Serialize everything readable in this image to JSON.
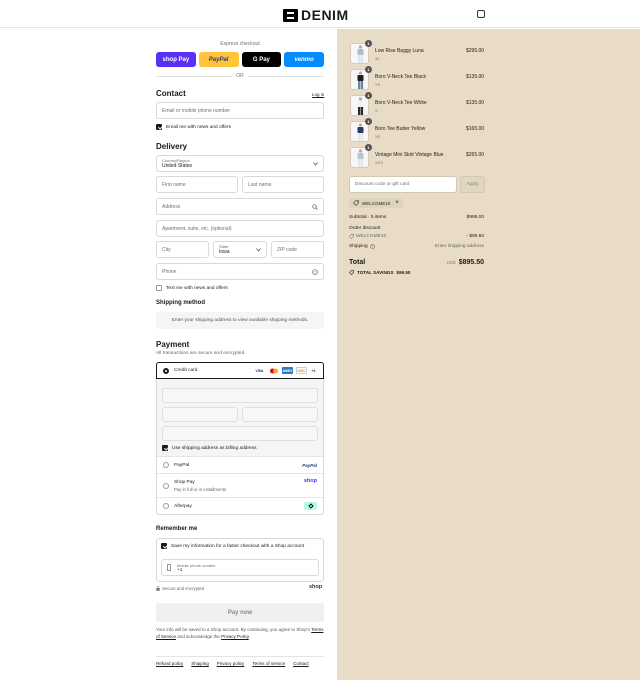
{
  "brand": {
    "name": "DENIM"
  },
  "express": {
    "label": "Express checkout",
    "buttons": [
      {
        "label": "shop Pay",
        "color": "#5a31f4"
      },
      {
        "label": "PayPal",
        "color": "#ffc439"
      },
      {
        "label": "G Pay",
        "color": "#000000"
      },
      {
        "label": "venmo",
        "color": "#008cff"
      }
    ],
    "or": "OR"
  },
  "contact": {
    "title": "Contact",
    "login": "Log in",
    "email_placeholder": "Email or mobile phone number",
    "news_label": "Email me with news and offers",
    "news_checked": true
  },
  "delivery": {
    "title": "Delivery",
    "country_label": "Country/Region",
    "country_value": "United States",
    "first_name": "First name",
    "last_name": "Last name",
    "address": "Address",
    "apartment": "Apartment, suite, etc. (optional)",
    "city": "City",
    "state_label": "State",
    "state_value": "Iowa",
    "zip": "ZIP code",
    "phone": "Phone",
    "sms_label": "Text me with news and offers"
  },
  "shipping": {
    "title": "Shipping method",
    "note": "Enter your shipping address to view available shipping methods."
  },
  "payment": {
    "title": "Payment",
    "subtitle": "All transactions are secure and encrypted.",
    "credit_card": "Credit card",
    "card_brands": [
      "VISA",
      "MC",
      "AMEX",
      "DISC",
      "+4"
    ],
    "billing_label": "Use shipping address as billing address",
    "paypal": "PayPal",
    "paypal_logo": "PayPal",
    "shop_pay": "Shop Pay",
    "shop_pay_sub": "Pay in full or in installments",
    "shop_logo": "shop",
    "afterpay": "Afterpay"
  },
  "remember": {
    "title": "Remember me",
    "save_label": "Save my information for a faster checkout with a Shop account",
    "phone_label": "Mobile phone number",
    "phone_prefix": "+1",
    "secure": "Secure and encrypted",
    "shop_logo": "shop"
  },
  "pay_now": "Pay now",
  "legal": {
    "text1": "Your info will be saved to a Shop account. By continuing, you agree to Shop's",
    "terms": "Terms of Service",
    "text2": "and acknowledge the",
    "privacy": "Privacy Policy",
    "period": "."
  },
  "footer": [
    "Refund policy",
    "Shipping",
    "Privacy policy",
    "Terms of service",
    "Contact"
  ],
  "cart": {
    "items": [
      {
        "name": "Low Rise Baggy Luna",
        "size": "30",
        "price": "$295.00",
        "qty": "1",
        "colors": [
          "#a9bfd3",
          "#dfe6ed"
        ]
      },
      {
        "name": "Boro V-Neck Tee Black",
        "size": "XS",
        "price": "$135.00",
        "qty": "1",
        "colors": [
          "#1e1e1e",
          "#6c86a8"
        ]
      },
      {
        "name": "Boro V-Neck Tee White",
        "size": "S",
        "price": "$135.00",
        "qty": "1",
        "colors": [
          "#f2f2f2",
          "#2c2c2c"
        ]
      },
      {
        "name": "Boro Tee Butter Yellow",
        "size": "XS",
        "price": "$165.00",
        "qty": "1",
        "colors": [
          "#2b3b66",
          "#e7e7e7"
        ]
      },
      {
        "name": "Vintage Mini Skirt Vintage Blue",
        "size": "XXS",
        "price": "$265.00",
        "qty": "1",
        "colors": [
          "#b9c6d6",
          "#e6e6e6"
        ]
      }
    ],
    "discount_placeholder": "Discount code or gift card",
    "apply": "Apply",
    "code": "WELCOME10",
    "subtotal_label": "Subtotal · 5 items",
    "subtotal_value": "$995.00",
    "order_discount_label": "Order discount",
    "discount_code": "WELCOME10",
    "discount_value": "- $99.50",
    "shipping_label": "Shipping",
    "shipping_value": "Enter shipping address",
    "total_label": "Total",
    "currency": "USD",
    "total_value": "$895.50",
    "savings_label": "TOTAL SAVINGS",
    "savings_value": "$99.50"
  },
  "colors": {
    "right_bg": "#e9dcc6",
    "accent": "#1a1a1a"
  }
}
